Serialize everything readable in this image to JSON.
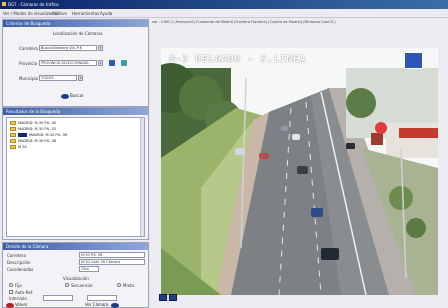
{
  "window": {
    "title": "DGT - Cámaras de tráfico"
  },
  "menubar": {
    "items": [
      "Ver / Modos de visualización",
      "Archivo",
      "Herramientas",
      "Ayuda"
    ]
  },
  "breadcrumb": "ver - CIRG-1 (Ferrocarril) Cuadrante de Madrid (Frontera Frontera) (Cuadro de Madrid) (Minizona Cara D.)",
  "search_panel": {
    "title": "Criterios de Búsqueda",
    "subtitle": "Localización de Cámaras",
    "carretera_label": "Carretera",
    "carretera_value": "Buscar/Nombre Vía, P.K",
    "provincia_label": "Provincia",
    "provincia_value": "PROVINCIA SELECCIONADA",
    "municipio_label": "Municipio",
    "municipio_value": "TODOS",
    "search_button": "Buscar"
  },
  "results_panel": {
    "title": "Resultados de la Búsqueda",
    "items": [
      "MADRID: M-30 P.K. 00",
      "MADRID: M-30 P.K. 03",
      "MADRID: M-30 P.K. 06",
      "MADRID: M-30 P.K. 08",
      "M-30"
    ]
  },
  "detail_panel": {
    "title": "Detalle de la Cámara",
    "carretera_label": "Carretera",
    "carretera_value": "M-30 P.K. 06",
    "descripcion_label": "Descripción",
    "descripcion_value": "M-30 Calle 30 Cámara",
    "coordenadas_label": "Coordenadas",
    "coordenadas_value": "25m",
    "visualizacion_label": "Visualización",
    "options": [
      "Fija",
      "Secuencial",
      "Mixta"
    ],
    "autoupdate_label": "Auto-Ref.",
    "interval_label": "Intervalo",
    "back_button": "Volver",
    "next_button": "Ver Cámara"
  },
  "camera": {
    "overlay_label": "M-3 DELGADO - S.LINEA",
    "colors": {
      "sky": "#f6f8f8",
      "road": "#7d8084",
      "grass": "#9ab46a",
      "badge": "#2e55b8"
    }
  },
  "controls": {
    "buttons": [
      "previous-camera",
      "next-camera"
    ]
  }
}
